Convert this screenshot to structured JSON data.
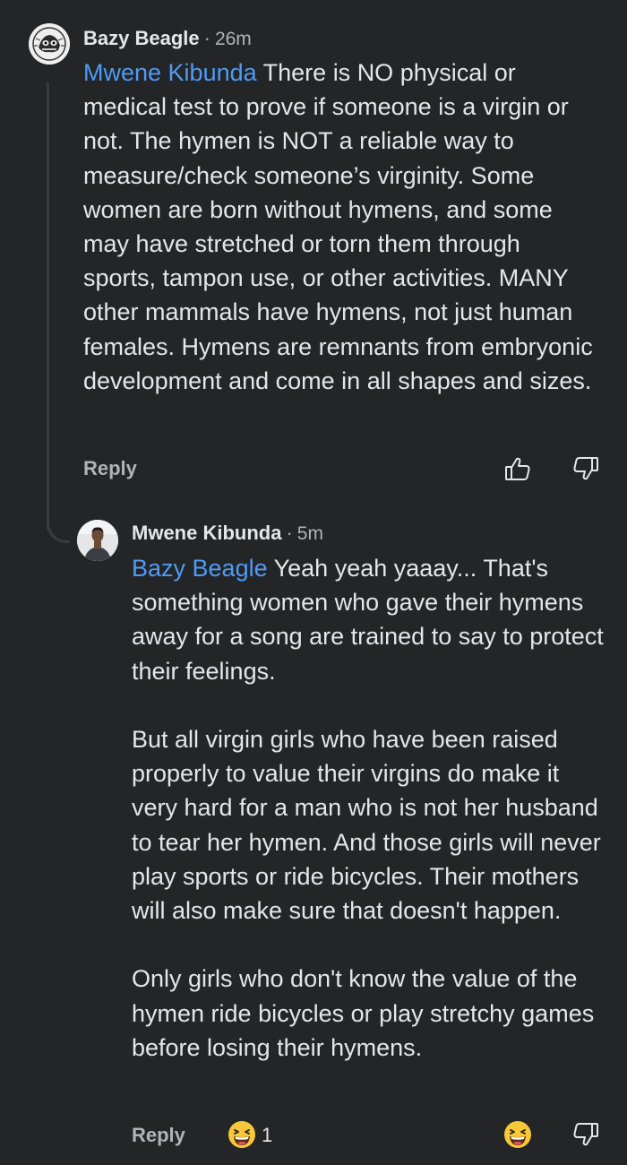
{
  "comment1": {
    "avatar_icon": "avatar-illustration-icon",
    "author": "Bazy Beagle",
    "separator": "·",
    "time": "26m",
    "mention": "Mwene Kibunda",
    "text": " There is NO physical or medical test to prove if someone is a virgin or not. The hymen is NOT a reliable way to measure/check someone’s virginity. Some women are born without hymens, and some may have stretched or torn them through sports, tampon use, or other activities. MANY other mammals have hymens, not just human females. Hymens are remnants from embryonic development and come in all shapes and sizes.",
    "reply_label": "Reply",
    "like_icon": "thumbs-up-icon",
    "dislike_icon": "thumbs-down-icon"
  },
  "comment2": {
    "avatar_icon": "avatar-photo-icon",
    "author": "Mwene Kibunda",
    "separator": "·",
    "time": "5m",
    "mention": "Bazy Beagle",
    "paragraph1": " Yeah yeah yaaay... That's something women who gave their hymens away for a song are trained to say to protect their feelings.",
    "paragraph2": "But all virgin girls who have been raised properly to value their virgins do make it very hard for a man who is not her husband to tear her hymen. And those girls will never play sports or ride bicycles. Their mothers will also make sure that doesn't happen.",
    "paragraph3": "Only girls who don't know the value of the hymen ride bicycles or play stretchy games before losing their hymens.",
    "reply_label": "Reply",
    "reaction_icon": "laughing-emoji-icon",
    "reaction_count": "1",
    "react_icon": "laughing-emoji-icon",
    "dislike_icon": "thumbs-down-icon"
  },
  "colors": {
    "background": "#232527",
    "mention": "#4f9bf5",
    "text": "#e4e6eb",
    "muted": "#b0b3b8"
  }
}
